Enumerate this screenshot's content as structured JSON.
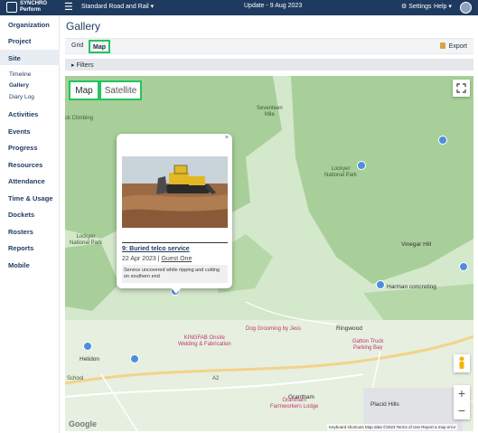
{
  "app": {
    "logo_text_line1": "SYNCHRO",
    "logo_text_line2": "Perform"
  },
  "header": {
    "menu_icon": "hamburger-icon",
    "project": "Standard Road and Rail",
    "update": "Update - 9 Aug 2023",
    "settings": "Settings",
    "help": "Help"
  },
  "sidebar": {
    "items": [
      {
        "label": "Organization"
      },
      {
        "label": "Project"
      },
      {
        "label": "Site"
      },
      {
        "label": "Activities"
      },
      {
        "label": "Events"
      },
      {
        "label": "Progress"
      },
      {
        "label": "Resources"
      },
      {
        "label": "Attendance"
      },
      {
        "label": "Time & Usage"
      },
      {
        "label": "Dockets"
      },
      {
        "label": "Rosters"
      },
      {
        "label": "Reports"
      },
      {
        "label": "Mobile"
      }
    ],
    "site_subitems": [
      {
        "label": "Timeline"
      },
      {
        "label": "Gallery"
      },
      {
        "label": "Diary Log"
      }
    ]
  },
  "page": {
    "title": "Gallery",
    "tabs": {
      "grid": "Grid",
      "map": "Map"
    },
    "export": "Export",
    "filters": "Filters"
  },
  "map": {
    "type_map": "Map",
    "type_satellite": "Satellite",
    "zoom_in": "+",
    "zoom_out": "−",
    "labels": {
      "rock_climbing": "ck Climbing",
      "seventeen_mile_1": "Seventeen",
      "seventeen_mile_2": "Mile",
      "lockyer_np_east_1": "Lockyer",
      "lockyer_np_east_2": "National Park",
      "lockyer_np_west_1": "Lockyer",
      "lockyer_np_west_2": "National Park",
      "vinegar_hill": "Vinegar Hill",
      "harman": "Harman concreting",
      "ringwood": "Ringwood",
      "dog_grooming": "Dog Grooming by Jess",
      "kingfab_1": "KINGFAB Onsite",
      "kingfab_2": "Welding & Fabrication",
      "gatton_truck_1": "Gatton Truck",
      "gatton_truck_2": "Parking Bay",
      "helidon": "Helidon",
      "school": "School",
      "grantham": "Grantham",
      "grantham_lodge_1": "Grantham",
      "grantham_lodge_2": "Farmworkers Lodge",
      "placid_hills": "Placid Hills",
      "road_a2": "A2"
    },
    "attribution": "Keyboard shortcuts   Map data ©2023   Terms of Use   Report a map error",
    "google": "Google"
  },
  "popup": {
    "title": "9: Buried telco service",
    "date": "22 Apr 2023",
    "separator": " | ",
    "author": "Guest One",
    "description": "Service uncovered while ripping and cutting on southern end",
    "close": "×"
  },
  "colors": {
    "header_bg": "#1e3a5f",
    "highlight": "#22c55e",
    "map_forest": "#a8cf99",
    "map_land": "#d4e8cb"
  }
}
